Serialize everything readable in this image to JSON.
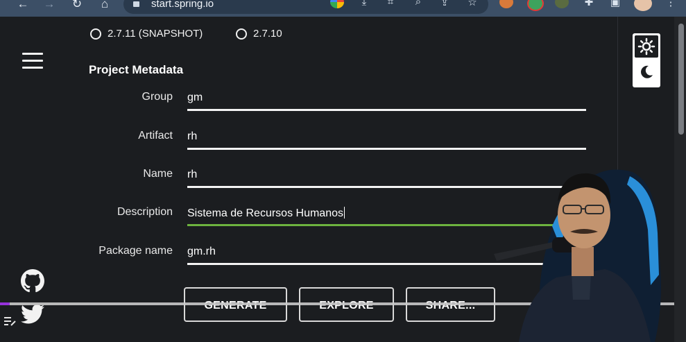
{
  "browser": {
    "url": "start.spring.io",
    "nav_back": "←",
    "nav_forward": "→",
    "nav_reload": "↻",
    "nav_home": "⌂"
  },
  "page": {
    "versions": [
      {
        "label": "2.7.11 (SNAPSHOT)"
      },
      {
        "label": "2.7.10"
      }
    ],
    "section_title": "Project Metadata",
    "fields": [
      {
        "label": "Group",
        "value": "gm"
      },
      {
        "label": "Artifact",
        "value": "rh"
      },
      {
        "label": "Name",
        "value": "rh"
      },
      {
        "label": "Description",
        "value": "Sistema de Recursos Humanos"
      },
      {
        "label": "Package name",
        "value": "gm.rh"
      }
    ],
    "buttons": {
      "generate": "GENERATE",
      "explore": "EXPLORE",
      "share": "SHARE..."
    }
  },
  "colors": {
    "background": "#1b1d20",
    "focus_underline": "#6db33f",
    "progress_played": "#a435f0"
  },
  "icons": [
    "menu-icon",
    "github-icon",
    "twitter-icon",
    "sun-icon",
    "moon-icon",
    "playlist-icon"
  ]
}
